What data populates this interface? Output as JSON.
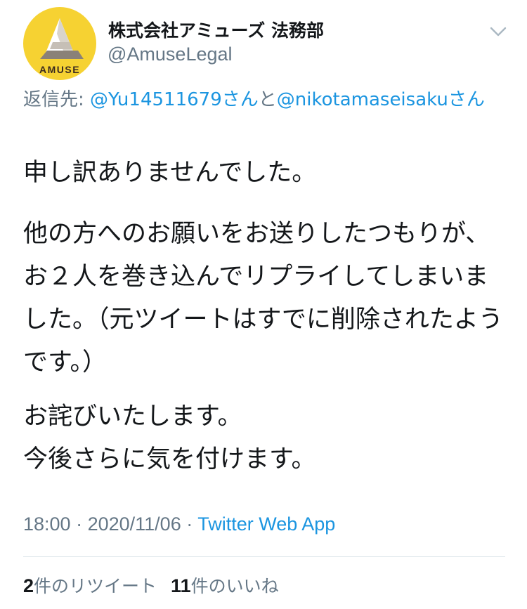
{
  "author": {
    "display_name": "株式会社アミューズ 法務部",
    "handle": "@AmuseLegal",
    "avatar": {
      "icon": "amuse-logo-icon",
      "logo_text": "AMUSE",
      "background_color": "#f6d232"
    }
  },
  "menu": {
    "icon": "chevron-down-icon"
  },
  "reply": {
    "prefix": "返信先: ",
    "user1": "@Yu14511679さん",
    "joiner": "と",
    "user2": "@nikotamaseisakuさん"
  },
  "body": {
    "paragraph1": "申し訳ありませんでした。",
    "paragraph2": "他の方へのお願いをお送りしたつもりが、お２人を巻き込んでリプライしてしまいました。（元ツイートはすでに削除されたようです。）",
    "paragraph3": "お詫びいたします。\n今後さらに気を付けます。"
  },
  "meta": {
    "time": "18:00",
    "date": "2020/11/06",
    "separator": " · ",
    "source": "Twitter Web App"
  },
  "stats": {
    "retweets_count": "2",
    "retweets_label": "件のリツイート",
    "likes_count": "11",
    "likes_label": "件のいいね"
  },
  "colors": {
    "link": "#1b95e0",
    "secondary_text": "#657786",
    "primary_text": "#14171a",
    "divider": "#e1e8ed"
  }
}
